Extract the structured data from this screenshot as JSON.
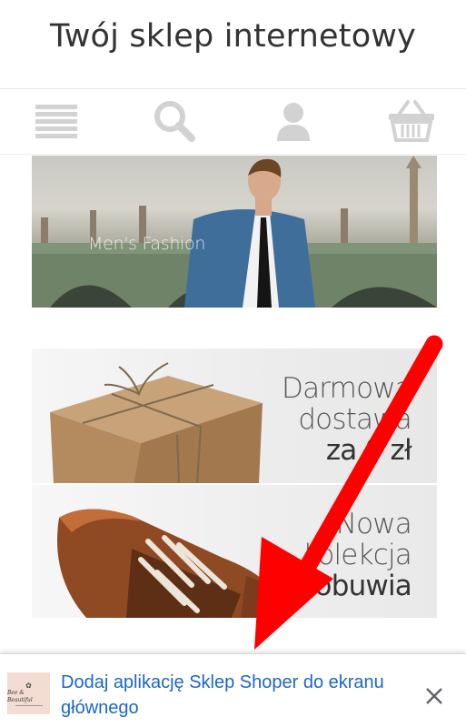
{
  "header": {
    "title": "Twój sklep internetowy"
  },
  "toolbar": {
    "icons": [
      "menu-icon",
      "search-icon",
      "user-icon",
      "cart-icon"
    ]
  },
  "banners": {
    "men": {
      "label": "Men's Fashion"
    },
    "delivery": {
      "line1": "Darmowa",
      "line2": "dostawa",
      "line3": "za 0 zł"
    },
    "shoes": {
      "line1": "Nowa",
      "line2": "kolekcja",
      "line3": "obuwia"
    }
  },
  "a2hs": {
    "icon_mark": "Bee & Beautiful",
    "text": "Dodaj aplikację Sklep Shoper do ekranu głównego",
    "close_icon": "close-icon"
  },
  "colors": {
    "link": "#1a66d1",
    "arrow": "#ff0000",
    "icon": "#d2d2d2"
  }
}
